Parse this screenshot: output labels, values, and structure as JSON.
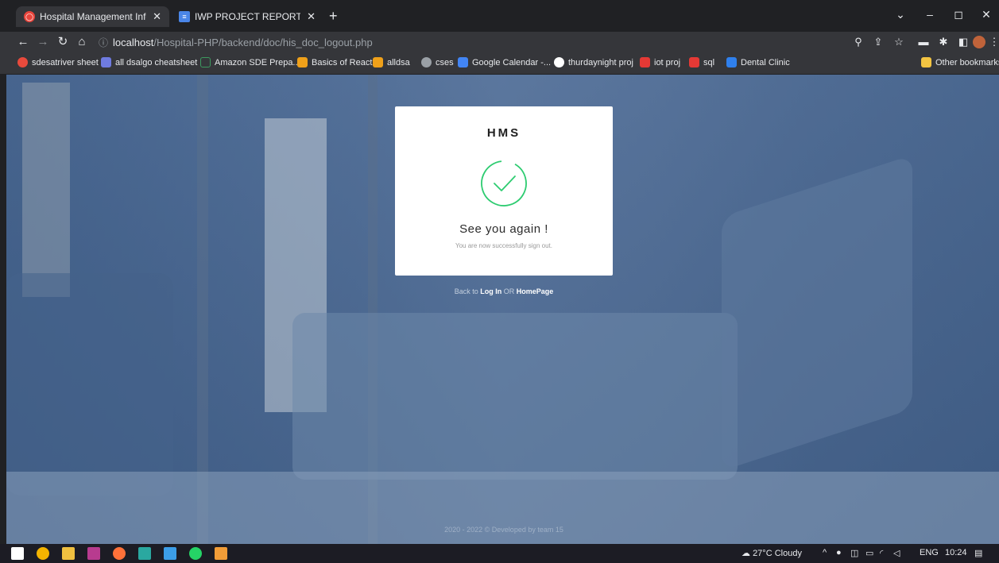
{
  "browser": {
    "tabs": [
      {
        "title": "Hospital Management Informati",
        "active": true,
        "favicon_color": "#e8453c"
      },
      {
        "title": "IWP PROJECT REPORT - Google D",
        "active": false,
        "favicon_color": "#4a86e8"
      }
    ],
    "url": {
      "host": "localhost",
      "path": "/Hospital-PHP/backend/doc/his_doc_logout.php"
    },
    "bookmarks": [
      {
        "label": "sdesatriver sheet",
        "color": "#e84a3c"
      },
      {
        "label": "all dsalgo cheatsheet",
        "color": "#6f7be0"
      },
      {
        "label": "Amazon SDE Prepa...",
        "color": "#35363a"
      },
      {
        "label": "Basics of React",
        "color": "#f0a11a"
      },
      {
        "label": "alldsa",
        "color": "#f0a11a"
      },
      {
        "label": "cses",
        "color": "#9aa0a6"
      },
      {
        "label": "Google Calendar -...",
        "color": "#4285f4"
      },
      {
        "label": "thurdaynight proj",
        "color": "#ffffff"
      },
      {
        "label": "iot proj",
        "color": "#e53935"
      },
      {
        "label": "sql",
        "color": "#e53935"
      },
      {
        "label": "Dental Clinic",
        "color": "#2f80ed"
      }
    ],
    "other_bookmarks": "Other bookmarks"
  },
  "page": {
    "logo": "HMS",
    "headline": "See you again !",
    "subtext": "You are now successfully sign out.",
    "back_prefix": "Back to",
    "login_link": "Log In",
    "or_text": "OR",
    "homepage_link": "HomePage",
    "footer": "2020 - 2022 © Developed by team 15",
    "accent_color": "#2ecc71"
  },
  "taskbar": {
    "weather": "27°C  Cloudy",
    "language": "ENG",
    "time": "10:24"
  }
}
